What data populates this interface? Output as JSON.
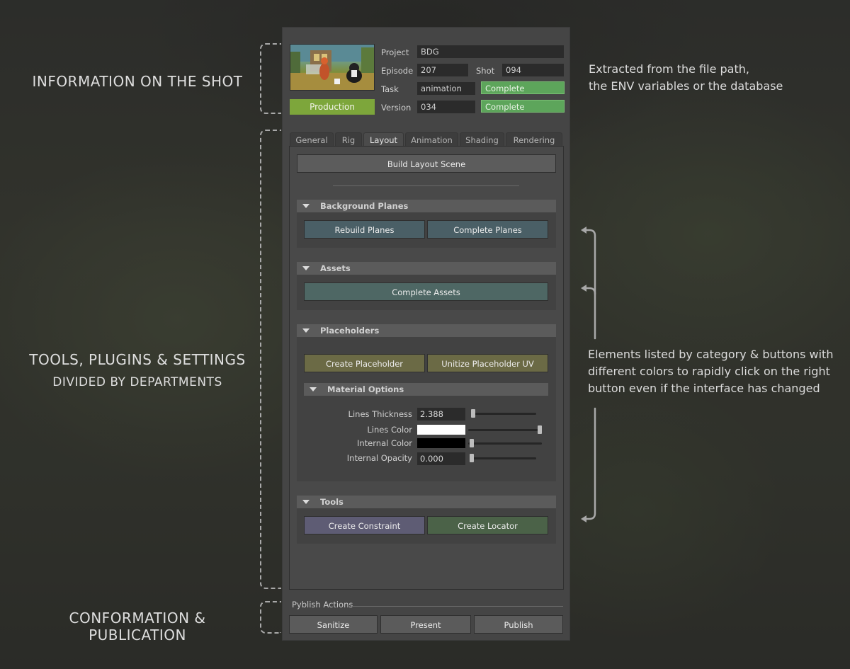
{
  "captions": {
    "shot_info": "INFORMATION ON THE SHOT",
    "tools_line1": "TOOLS, PLUGINS & SETTINGS",
    "tools_line2": "DIVIDED BY DEPARTMENTS",
    "publication": "CONFORMATION & PUBLICATION"
  },
  "notes": {
    "extracted_line1": "Extracted from the file path,",
    "extracted_line2": "the ENV variables or the database",
    "elements_line1": "Elements listed by category & buttons with",
    "elements_line2": "different colors to rapidly click on the right",
    "elements_line3": "button even if the interface has changed"
  },
  "shot": {
    "project_label": "Project",
    "project_value": "BDG",
    "episode_label": "Episode",
    "episode_value": "207",
    "shot_label": "Shot",
    "shot_value": "094",
    "task_label": "Task",
    "task_value": "animation",
    "task_status": "Complete",
    "version_label": "Version",
    "version_value": "034",
    "version_status": "Complete",
    "production_label": "Production"
  },
  "tabs": [
    "General",
    "Rig",
    "Layout",
    "Animation",
    "Shading",
    "Rendering"
  ],
  "active_tab": "Layout",
  "layout": {
    "build_button": "Build Layout Scene",
    "background_planes": {
      "title": "Background Planes",
      "rebuild": "Rebuild Planes",
      "complete": "Complete Planes"
    },
    "assets": {
      "title": "Assets",
      "complete": "Complete Assets"
    },
    "placeholders": {
      "title": "Placeholders",
      "create": "Create Placeholder",
      "unitize": "Unitize Placeholder UV",
      "material_options": {
        "title": "Material Options",
        "lines_thickness_label": "Lines Thickness",
        "lines_thickness_value": "2.388",
        "lines_color_label": "Lines Color",
        "lines_color": "#ffffff",
        "internal_color_label": "Internal Color",
        "internal_color": "#000000",
        "internal_opacity_label": "Internal Opacity",
        "internal_opacity_value": "0.000"
      }
    },
    "tools": {
      "title": "Tools",
      "constraint": "Create Constraint",
      "locator": "Create Locator"
    }
  },
  "publish": {
    "label": "Pyblish Actions",
    "sanitize": "Sanitize",
    "present": "Present",
    "publish": "Publish"
  },
  "colors": {
    "status_green": "#5da55b",
    "production": "#7da63b",
    "btn_blue": "#4a5f66",
    "btn_teal": "#4e6764",
    "btn_olive": "#6b6a45",
    "btn_purple": "#5e5c74",
    "btn_green": "#4b6248"
  }
}
